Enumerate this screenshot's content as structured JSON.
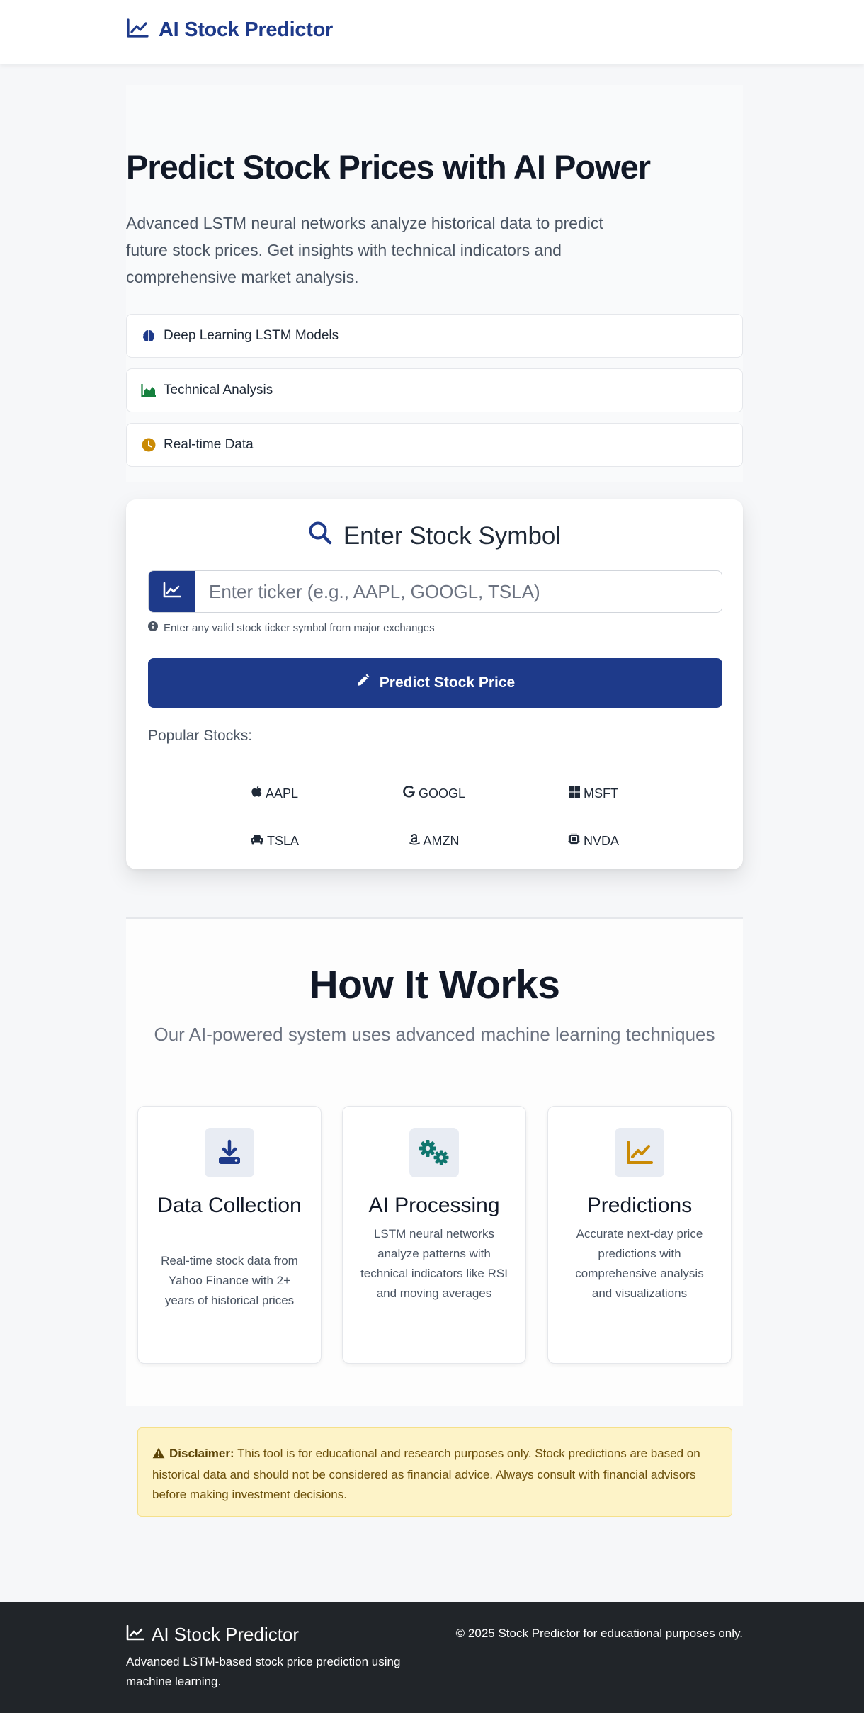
{
  "navbar": {
    "brand": "AI Stock Predictor"
  },
  "hero": {
    "title": "Predict Stock Prices with AI Power",
    "description": "Advanced LSTM neural networks analyze historical data to predict future stock prices. Get insights with technical indicators and comprehensive market analysis.",
    "features": [
      {
        "label": "Deep Learning LSTM Models",
        "icon": "brain-icon",
        "color": "#1e3a8a"
      },
      {
        "label": "Technical Analysis",
        "icon": "chart-area-icon",
        "color": "#15803d"
      },
      {
        "label": "Real-time Data",
        "icon": "clock-icon",
        "color": "#ca8a04"
      }
    ]
  },
  "search": {
    "title": "Enter Stock Symbol",
    "input_placeholder": "Enter ticker (e.g., AAPL, GOOGL, TSLA)",
    "input_value": "",
    "hint": "Enter any valid stock ticker symbol from major exchanges",
    "button_label": "Predict Stock Price",
    "popular_label": "Popular Stocks:",
    "popular": [
      {
        "symbol": "AAPL",
        "icon": "apple-icon"
      },
      {
        "symbol": "GOOGL",
        "icon": "google-icon"
      },
      {
        "symbol": "MSFT",
        "icon": "windows-icon"
      },
      {
        "symbol": "TSLA",
        "icon": "car-icon"
      },
      {
        "symbol": "AMZN",
        "icon": "amazon-icon"
      },
      {
        "symbol": "NVDA",
        "icon": "microchip-icon"
      }
    ]
  },
  "how": {
    "title": "How It Works",
    "subtitle": "Our AI-powered system uses advanced machine learning techniques",
    "steps": [
      {
        "title": "Data Collection",
        "description": "Real-time stock data from Yahoo Finance with 2+ years of historical prices",
        "icon": "download-icon"
      },
      {
        "title": "AI Processing",
        "description": "LSTM neural networks analyze patterns with technical indicators like RSI and moving averages",
        "icon": "gears-icon"
      },
      {
        "title": "Predictions",
        "description": "Accurate next-day price predictions with comprehensive analysis and visualizations",
        "icon": "chart-line-icon"
      }
    ]
  },
  "disclaimer": {
    "label": "Disclaimer:",
    "text": "This tool is for educational and research purposes only. Stock predictions are based on historical data and should not be considered as financial advice. Always consult with financial advisors before making investment decisions."
  },
  "footer": {
    "brand": "AI Stock Predictor",
    "description": "Advanced LSTM-based stock price prediction using machine learning.",
    "copyright": "© 2025 Stock Predictor for educational purposes only."
  },
  "colors": {
    "primary": "#1e3a8a",
    "success": "#15803d",
    "warning": "#ca8a04",
    "footer_bg": "#212529",
    "disclaimer_bg": "#fdf3c8"
  }
}
